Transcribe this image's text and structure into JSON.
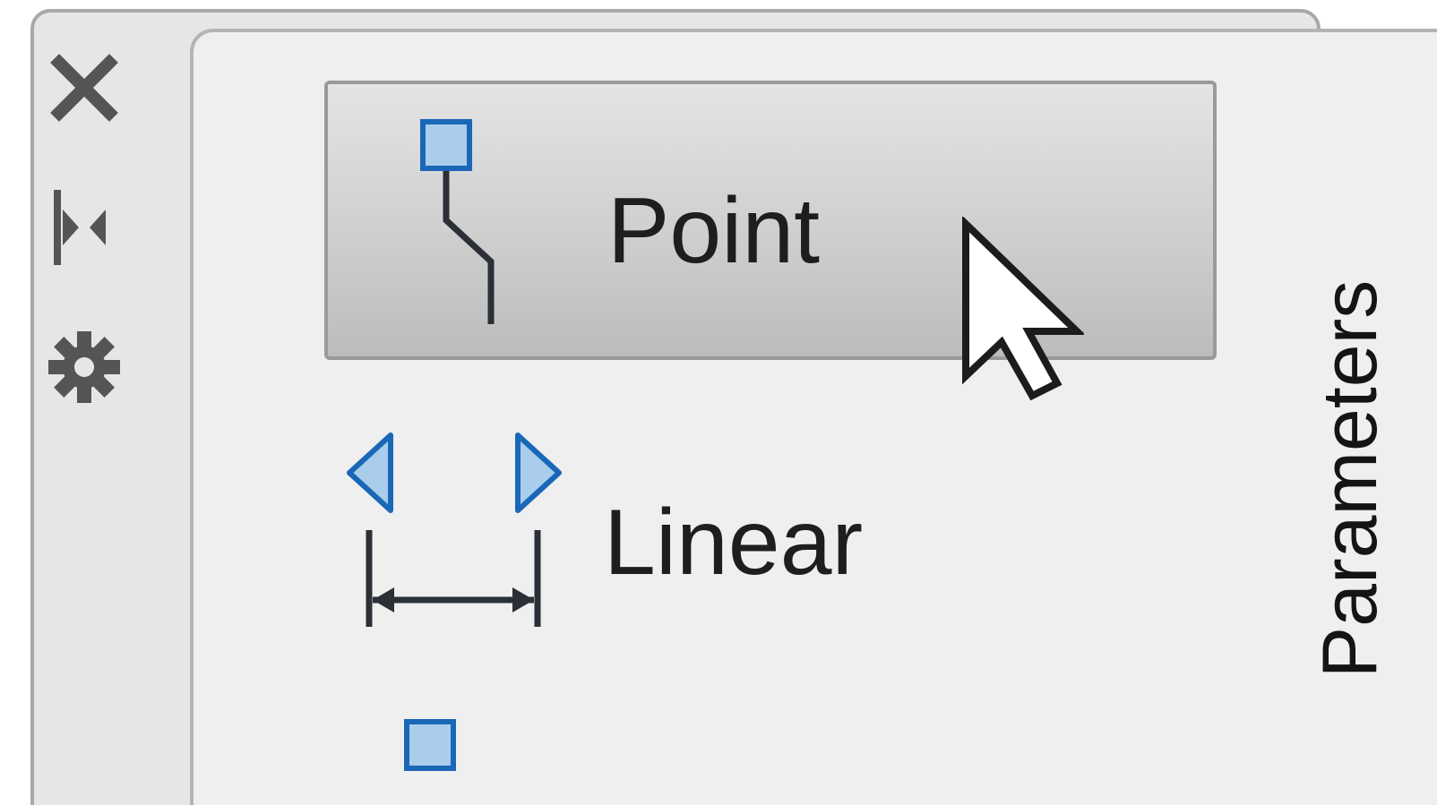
{
  "palette": {
    "toolbar": {
      "close_icon": "close-icon",
      "auto_hide_icon": "auto-hide-icon",
      "properties_icon": "properties-icon"
    },
    "items": [
      {
        "label": "Point",
        "icon": "point-parameter-icon",
        "state": "hover"
      },
      {
        "label": "Linear",
        "icon": "linear-parameter-icon",
        "state": "normal"
      },
      {
        "label": "",
        "icon": "polar-parameter-icon",
        "state": "normal"
      }
    ],
    "tab_label": "Parameters"
  },
  "colors": {
    "grip_fill": "#a9cdea",
    "grip_border": "#1a67b8",
    "icon_stroke": "#2b2f36",
    "frame": "#a8a8a8"
  }
}
